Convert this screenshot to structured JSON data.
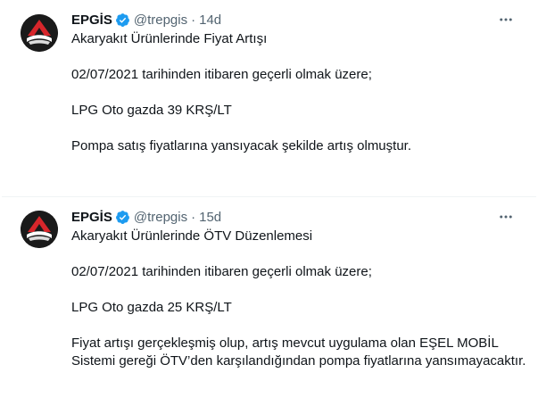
{
  "tweets": [
    {
      "author": "EPGİS",
      "handle": "@trepgis",
      "separator": "·",
      "time": "14d",
      "lines": [
        "Akaryakıt Ürünlerinde Fiyat Artışı",
        "02/07/2021 tarihinden itibaren geçerli olmak üzere;",
        "LPG Oto gazda 39 KRŞ/LT",
        "Pompa satış fiyatlarına yansıyacak şekilde artış olmuştur."
      ]
    },
    {
      "author": "EPGİS",
      "handle": "@trepgis",
      "separator": "·",
      "time": "15d",
      "lines": [
        "Akaryakıt Ürünlerinde ÖTV Düzenlemesi",
        "02/07/2021 tarihinden itibaren geçerli olmak üzere;",
        "LPG Oto gazda 25 KRŞ/LT",
        "Fiyat artışı gerçekleşmiş olup, artış mevcut uygulama olan EŞEL MOBİL",
        "Sistemi gereği ÖTV’den karşılandığından pompa fiyatlarına yansımayacaktır."
      ]
    }
  ],
  "icons": {
    "verified": "verified-badge-icon",
    "more": "more-options-icon",
    "avatar": "epgis-logo"
  },
  "colors": {
    "text": "#0f1419",
    "secondary": "#536471",
    "verified": "#1d9bf0",
    "logo_red": "#d7262b",
    "logo_dark": "#1a1a1a"
  }
}
